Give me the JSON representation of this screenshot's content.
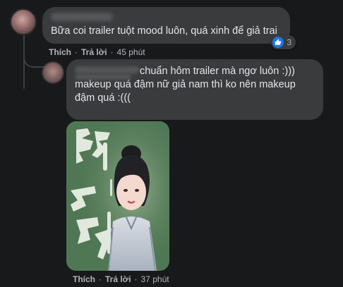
{
  "comment": {
    "text": "Bữa coi trailer tuột mood luôn, quá xinh để giả trai",
    "reaction_count": "3",
    "actions": {
      "like": "Thích",
      "reply": "Trả lời",
      "time": "45 phút"
    }
  },
  "reply": {
    "text_line1": "chuẩn hôm trailer mà ngơ luôn :)))",
    "text_line2": "makeup quá đậm nữ giả nam thì ko nên makeup",
    "text_line3": "đậm quá :(((",
    "actions": {
      "like": "Thích",
      "reply": "Trả lời",
      "time": "37 phút"
    }
  },
  "colors": {
    "background": "#18191a",
    "bubble": "#3a3b3c",
    "text": "#e4e6eb",
    "muted": "#b0b3b8",
    "like_blue": "#1877f2"
  },
  "icons": {
    "reaction": "like-icon"
  }
}
